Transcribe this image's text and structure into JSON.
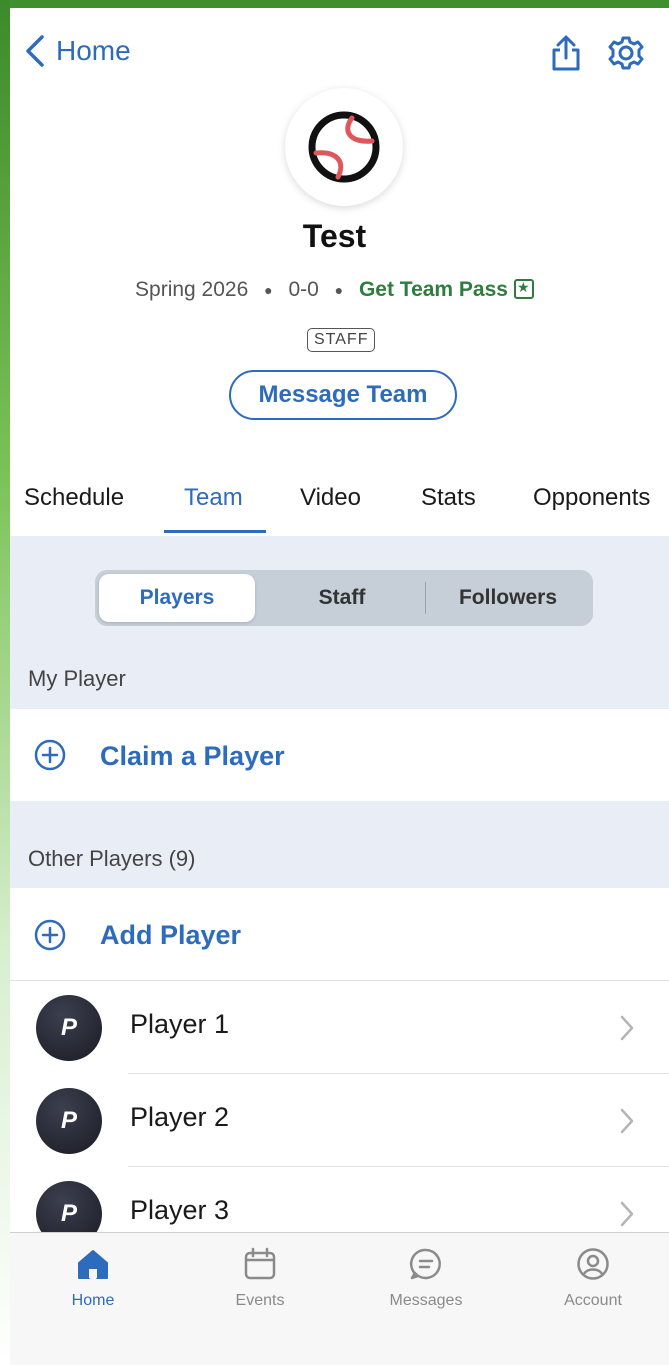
{
  "header": {
    "back_label": "Home",
    "icons": [
      "chevron-left-icon",
      "share-icon",
      "gear-icon",
      "baseball-icon"
    ]
  },
  "team": {
    "name": "Test",
    "season": "Spring 2026",
    "record": "0-0",
    "pass_label": "Get Team Pass",
    "role_badge": "STAFF",
    "message_button": "Message Team"
  },
  "tabs": [
    {
      "label": "Schedule"
    },
    {
      "label": "Team"
    },
    {
      "label": "Video"
    },
    {
      "label": "Stats"
    },
    {
      "label": "Opponents"
    }
  ],
  "active_tab": "Team",
  "segments": [
    {
      "label": "Players"
    },
    {
      "label": "Staff"
    },
    {
      "label": "Followers"
    }
  ],
  "active_segment": "Players",
  "my_player": {
    "section_label": "My Player",
    "claim_label": "Claim a Player"
  },
  "other_players": {
    "section_label": "Other Players (9)",
    "add_label": "Add Player",
    "players": [
      {
        "initial": "P",
        "name": "Player 1"
      },
      {
        "initial": "P",
        "name": "Player 2"
      },
      {
        "initial": "P",
        "name": "Player 3"
      }
    ]
  },
  "bottom_nav": [
    {
      "label": "Home",
      "icon": "home-icon"
    },
    {
      "label": "Events",
      "icon": "calendar-icon"
    },
    {
      "label": "Messages",
      "icon": "message-icon"
    },
    {
      "label": "Account",
      "icon": "account-icon"
    }
  ],
  "colors": {
    "accent": "#2d6bbd",
    "pass_green": "#2f7d3e",
    "frame_green": "#3f8f2e"
  }
}
